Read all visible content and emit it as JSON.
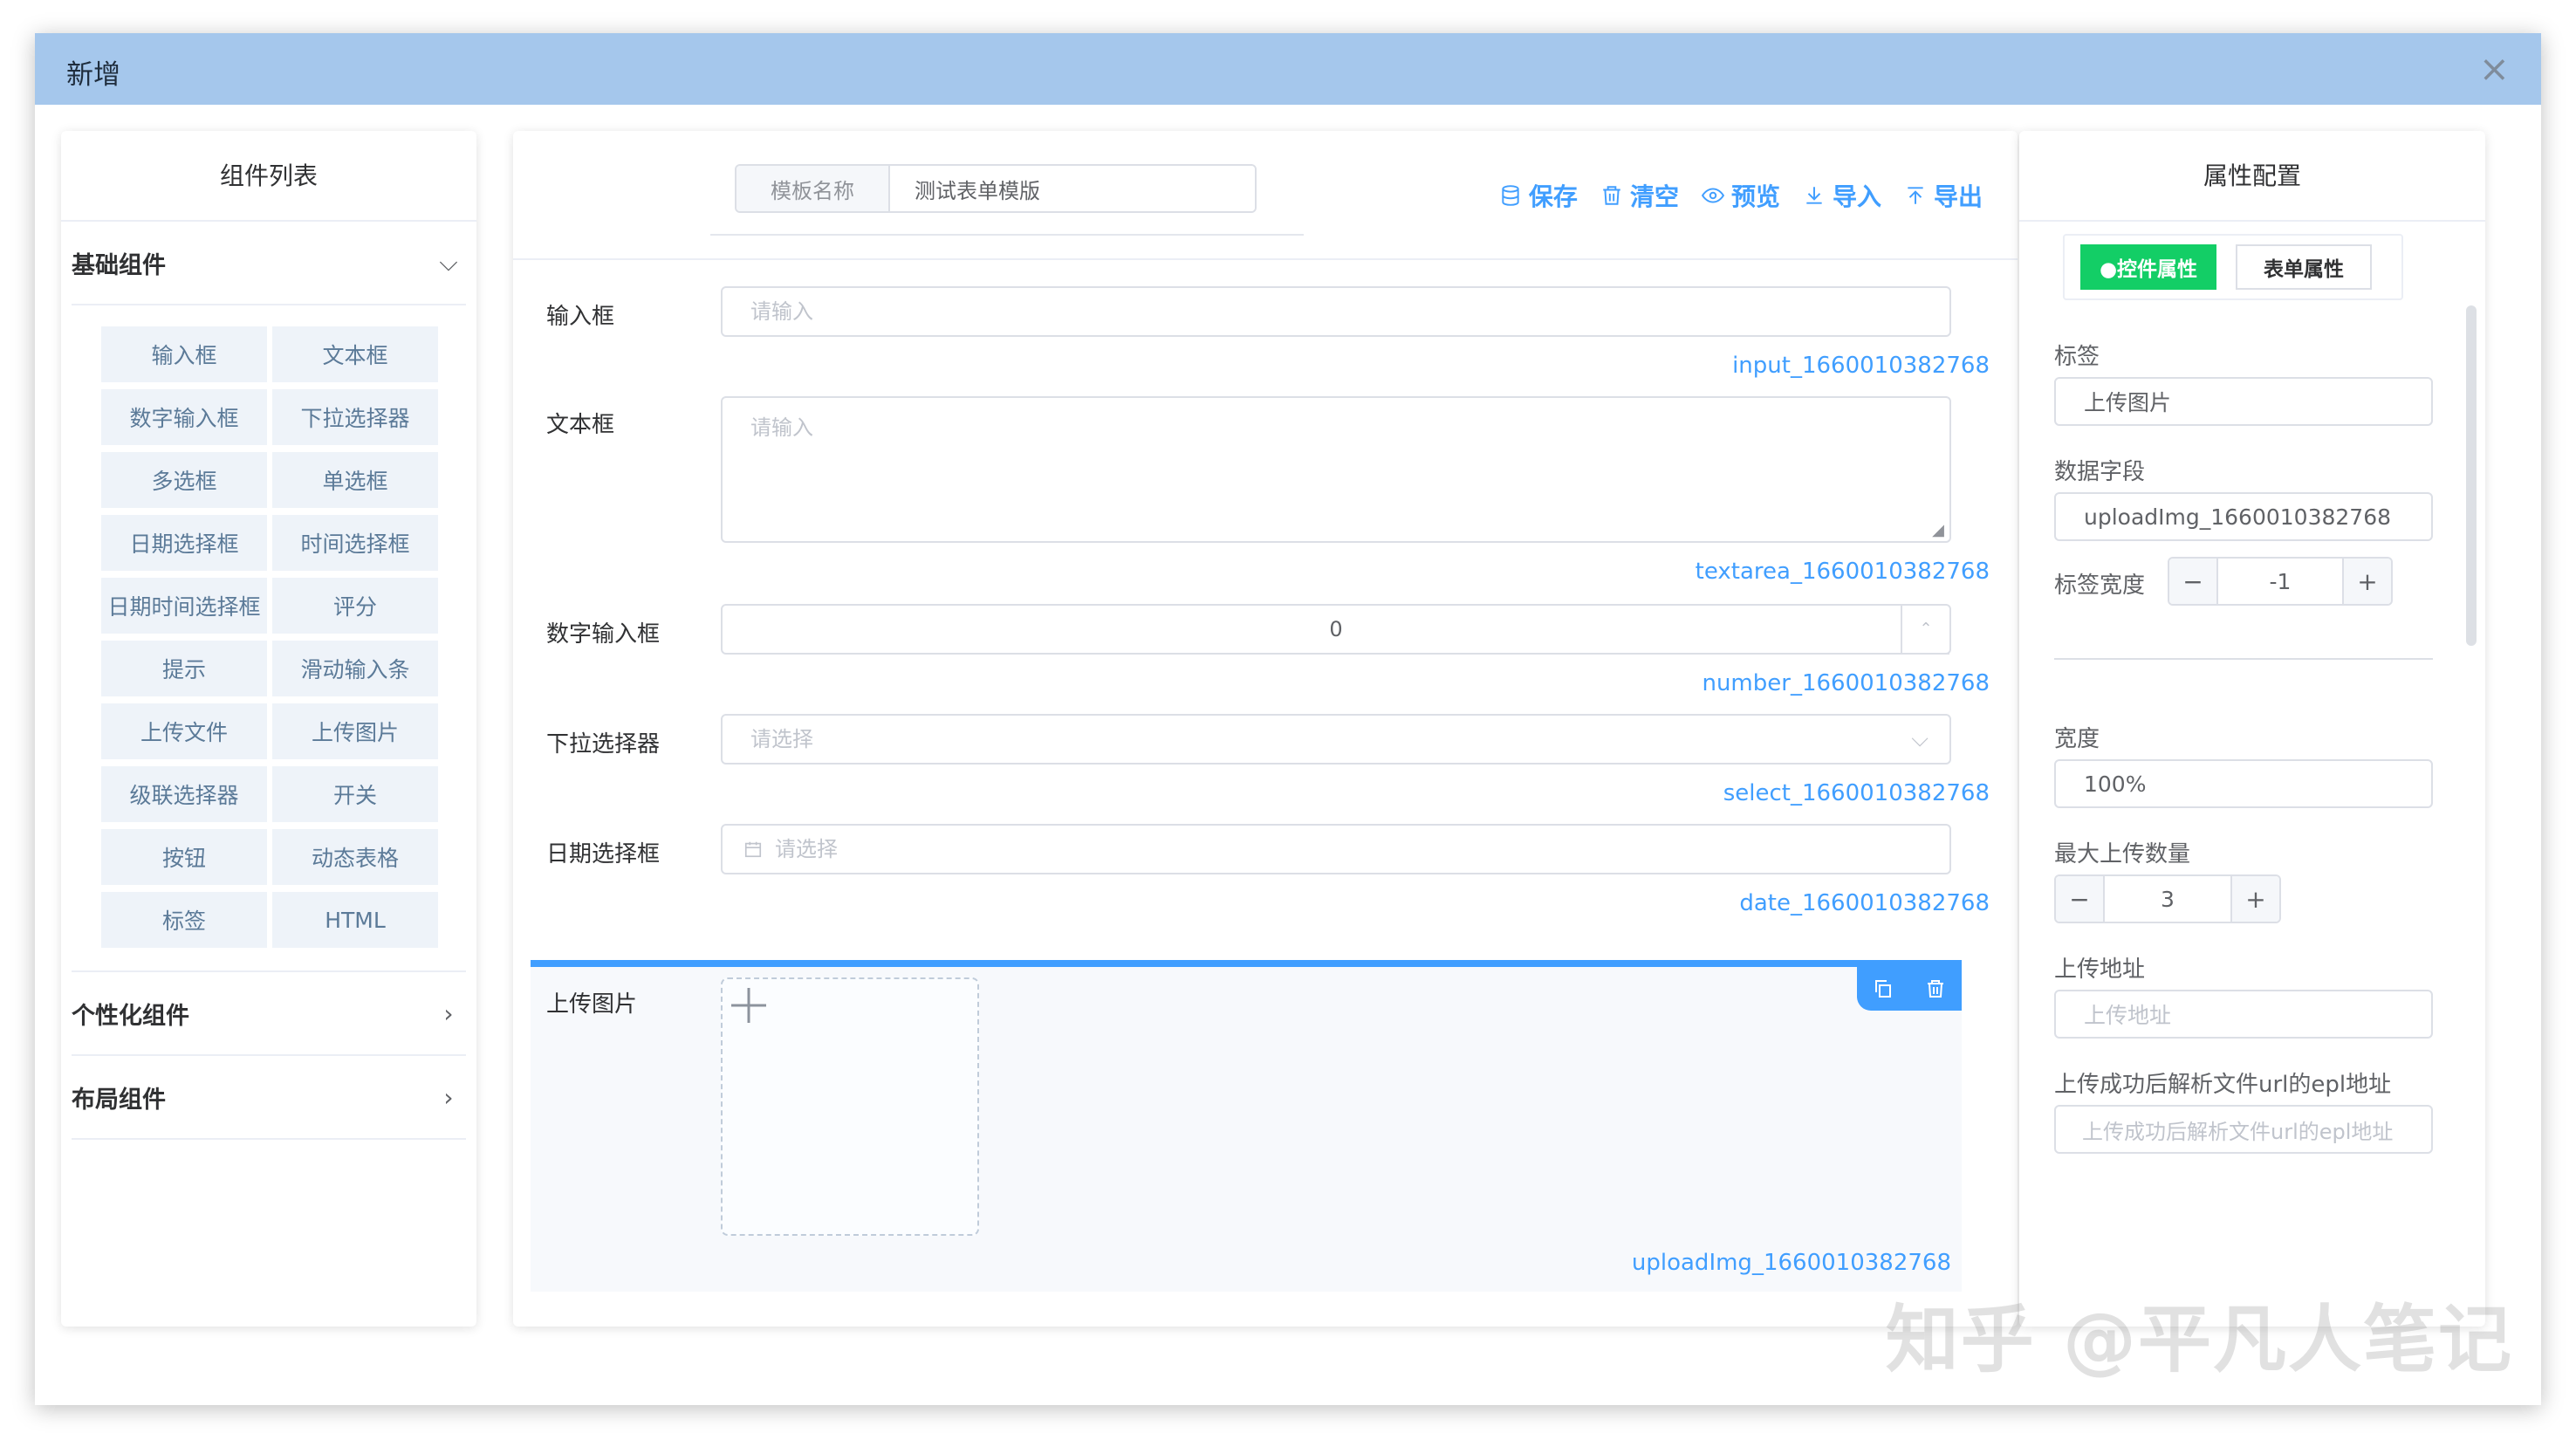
{
  "dialog": {
    "title": "新增",
    "close_icon": "close-icon"
  },
  "left": {
    "title": "组件列表",
    "basic_group": "基础组件",
    "basic_items": [
      "输入框",
      "文本框",
      "数字输入框",
      "下拉选择器",
      "多选框",
      "单选框",
      "日期选择框",
      "时间选择框",
      "日期时间选择框",
      "评分",
      "提示",
      "滑动输入条",
      "上传文件",
      "上传图片",
      "级联选择器",
      "开关",
      "按钮",
      "动态表格",
      "标签",
      "HTML"
    ],
    "custom_group": "个性化组件",
    "layout_group": "布局组件"
  },
  "center": {
    "template_label": "模板名称",
    "template_value": "测试表单模版",
    "tools": {
      "save": "保存",
      "clear": "清空",
      "preview": "预览",
      "import": "导入",
      "export": "导出"
    },
    "fields": {
      "input": {
        "label": "输入框",
        "placeholder": "请输入",
        "id": "input_1660010382768"
      },
      "textarea": {
        "label": "文本框",
        "placeholder": "请输入",
        "id": "textarea_1660010382768"
      },
      "number": {
        "label": "数字输入框",
        "value": "0",
        "id": "number_1660010382768"
      },
      "select": {
        "label": "下拉选择器",
        "placeholder": "请选择",
        "id": "select_1660010382768"
      },
      "date": {
        "label": "日期选择框",
        "placeholder": "请选择",
        "id": "date_1660010382768"
      },
      "upload": {
        "label": "上传图片",
        "id": "uploadImg_1660010382768"
      }
    }
  },
  "right": {
    "title": "属性配置",
    "tab_control": "●控件属性",
    "tab_form": "表单属性",
    "label_label": "标签",
    "label_value": "上传图片",
    "field_label": "数据字段",
    "field_value": "uploadImg_1660010382768",
    "label_width_label": "标签宽度",
    "label_width_value": "-1",
    "width_label": "宽度",
    "width_value": "100%",
    "max_upload_label": "最大上传数量",
    "max_upload_value": "3",
    "upload_url_label": "上传地址",
    "upload_url_placeholder": "上传地址",
    "parse_label": "上传成功后解析文件url的epl地址",
    "parse_placeholder": "上传成功后解析文件url的epl地址"
  },
  "watermark": "知乎 @平凡人笔记"
}
